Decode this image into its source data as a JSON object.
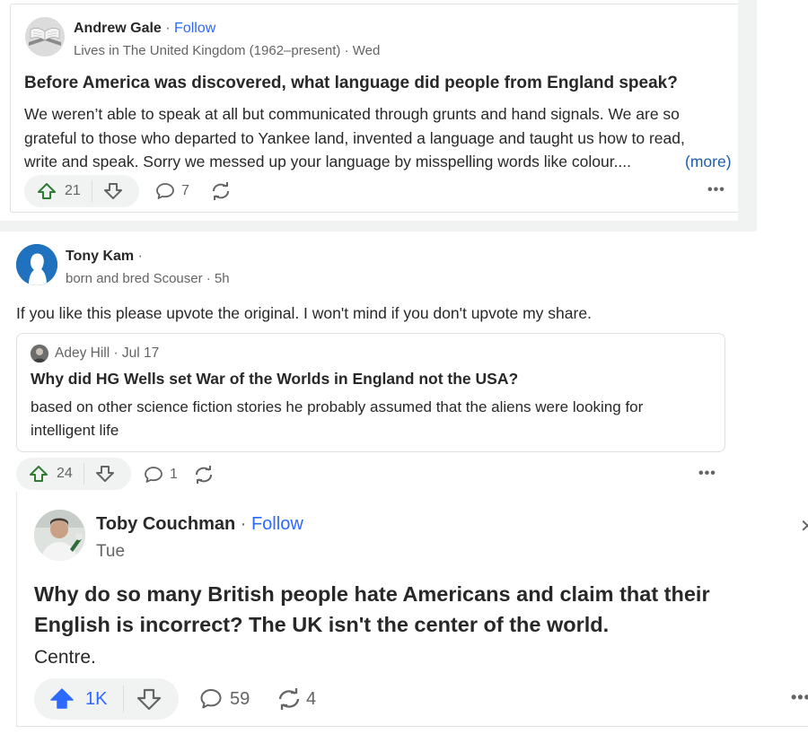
{
  "post1": {
    "author": "Andrew Gale",
    "follow": "Follow",
    "meta": "Lives in The United Kingdom (1962–present) · Wed",
    "question": "Before America was discovered, what language did people from England speak?",
    "answer_line1": "We weren’t able to speak at all but communicated through grunts and hand signals. We are so",
    "answer_line2": "grateful to those who departed to Yankee land, invented a language and taught us how to read,",
    "answer_line3": "write and speak. Sorry we messed up your language by misspelling words like colour....",
    "more": "(more)",
    "upvotes": "21",
    "comments": "7"
  },
  "post2": {
    "author": "Tony Kam",
    "meta": "born and bred Scouser · 5h",
    "share_text": "If you like this please upvote the original. I won't mind if you don't upvote my share.",
    "embed_author": "Adey Hill · Jul 17",
    "embed_question": "Why did HG Wells set War of the Worlds in England not the USA?",
    "embed_line1": "based on other science fiction stories he probably assumed that the aliens were looking for",
    "embed_line2": "intelligent life",
    "upvotes": "24",
    "comments": "1"
  },
  "post3": {
    "author": "Toby Couchman",
    "follow": "Follow",
    "meta": "Tue",
    "question_line1": "Why do so many British people hate Americans and claim that their",
    "question_line2": "English is incorrect? The UK isn't the center of the world.",
    "answer": "Centre.",
    "upvotes": "1K",
    "comments": "59",
    "shares": "4"
  },
  "colors": {
    "accent_blue": "#2e69ff",
    "upvote_green": "#2e7d32",
    "upvote_active": "#2e69ff"
  }
}
